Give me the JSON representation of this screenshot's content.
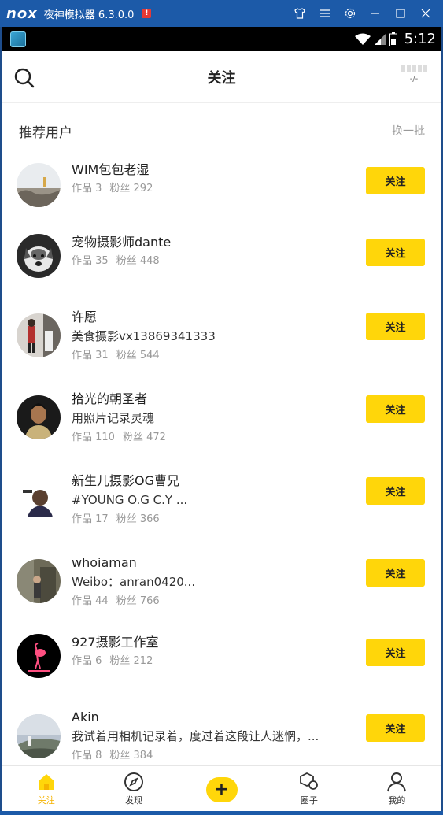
{
  "emulator": {
    "logo": "nox",
    "title": "夜神模拟器 6.3.0.0",
    "alert": "!"
  },
  "status_bar": {
    "time": "5:12"
  },
  "header": {
    "title": "关注",
    "signal_text": "-/-"
  },
  "section": {
    "title": "推荐用户",
    "refresh_label": "换一批"
  },
  "follow_label": "关注",
  "users": [
    {
      "name": "WIM包包老湿",
      "bio": "",
      "works": "作品 3",
      "fans": "粉丝 292"
    },
    {
      "name": "宠物摄影师dante",
      "bio": "",
      "works": "作品 35",
      "fans": "粉丝 448"
    },
    {
      "name": "许愿",
      "bio": "美食摄影vx13869341333",
      "works": "作品 31",
      "fans": "粉丝 544"
    },
    {
      "name": "拾光的朝圣者",
      "bio": "用照片记录灵魂",
      "works": "作品 110",
      "fans": "粉丝 472"
    },
    {
      "name": "新生儿摄影OG曹兄",
      "bio": "#YOUNG O.G C.Y ...",
      "works": "作品 17",
      "fans": "粉丝 366"
    },
    {
      "name": "whoiaman",
      "bio": "Weibo：anran0420...",
      "works": "作品 44",
      "fans": "粉丝 766"
    },
    {
      "name": "927摄影工作室",
      "bio": "",
      "works": "作品 6",
      "fans": "粉丝 212"
    },
    {
      "name": "Akin",
      "bio": "我试着用相机记录着，度过着这段让人迷惘，...",
      "works": "作品 8",
      "fans": "粉丝 384"
    }
  ],
  "nav": {
    "follow": "关注",
    "discover": "发现",
    "add": "+",
    "circle": "圈子",
    "me": "我的"
  },
  "colors": {
    "accent": "#ffd60a",
    "active_tab": "#f5b300",
    "emulator_bar": "#1c5aa8"
  }
}
